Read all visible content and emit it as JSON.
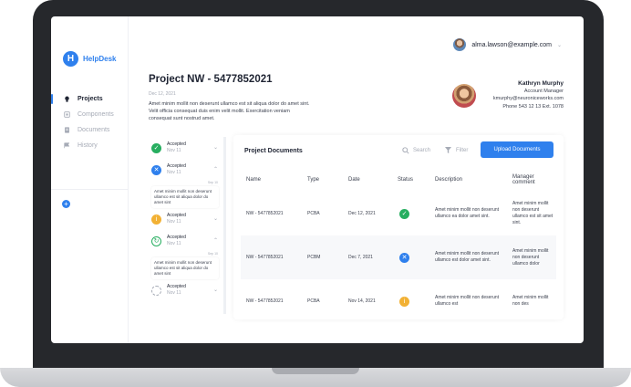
{
  "app": {
    "logo_letter": "H",
    "name": "HelpDesk"
  },
  "sidebar": {
    "items": [
      {
        "label": "Projects",
        "icon": "lightbulb-icon",
        "active": true
      },
      {
        "label": "Components",
        "icon": "component-icon",
        "active": false
      },
      {
        "label": "Documents",
        "icon": "document-icon",
        "active": false
      },
      {
        "label": "History",
        "icon": "history-icon",
        "active": false
      }
    ],
    "add_symbol": "+"
  },
  "header": {
    "user_email": "alma.lawson@example.com",
    "chevron": "⌄"
  },
  "project": {
    "title": "Project NW - 5477852021",
    "date": "Dec 12, 2021",
    "description": "Amet minim mollit non deserunt ullamco est sit aliqua dolor do amet sint. Velit officia consequat duis enim velit mollit. Exercitation veniam consequat sunt nostrud amet."
  },
  "manager": {
    "name": "Kathryn Murphy",
    "role": "Account Manager",
    "email": "kmurphy@neuroniceworks.com",
    "phone": "Phone 543 12 13 Ext. 1078"
  },
  "timeline": [
    {
      "status": "Accepted",
      "date": "Nov 11",
      "icon": "check-icon",
      "color": "#27ae60",
      "expanded": false
    },
    {
      "status": "Accepted",
      "date": "Nov 11",
      "icon": "x-icon",
      "color": "#2f80ed",
      "expanded": true,
      "time": "Sep 10",
      "comment": "Amet minim mollit non deserunt ullamco est sit aliqua dolor do amet sint"
    },
    {
      "status": "Accepted",
      "date": "Nov 11",
      "icon": "info-icon",
      "color": "#f2b134",
      "expanded": false
    },
    {
      "status": "Accepted",
      "date": "Nov 11",
      "icon": "refresh-icon",
      "color": "#27ae60",
      "expanded": true,
      "time": "Sep 10",
      "comment": "Amet minim mollit non deserunt ullamco est sit aliqua dolor do amet sint"
    },
    {
      "status": "Accepted",
      "date": "Nov 11",
      "icon": "spinner-icon",
      "color": "#a6abb6",
      "expanded": false
    }
  ],
  "documents": {
    "title": "Project Documents",
    "search_label": "Search",
    "filter_label": "Filter",
    "upload_label": "Upload Documents",
    "columns": [
      "Name",
      "Type",
      "Date",
      "Status",
      "Description",
      "Manager comment"
    ],
    "rows": [
      {
        "name": "NW - 5477852021",
        "type": "PCBA",
        "date": "Dec 12, 2021",
        "status_icon": "check-icon",
        "status_color": "#27ae60",
        "description": "Amet minim mollit non deserunt ullamco ea dolor amet sint.",
        "comment": "Amet minim mollit non deserunt ullamco est sit amet sint."
      },
      {
        "name": "NW - 5477852021",
        "type": "PCBM",
        "date": "Dec 7, 2021",
        "status_icon": "x-icon",
        "status_color": "#2f80ed",
        "description": "Amet minim mollit non deserunt ullamco est dolor amet sint.",
        "comment": "Amet minim mollit non deserunt ullamco dolor"
      },
      {
        "name": "NW - 5477852021",
        "type": "PCBA",
        "date": "Nov 14, 2021",
        "status_icon": "info-icon",
        "status_color": "#f2b134",
        "description": "Amet minim mollit non deserunt ullamco est",
        "comment": "Amet minim mollit non des"
      }
    ]
  }
}
